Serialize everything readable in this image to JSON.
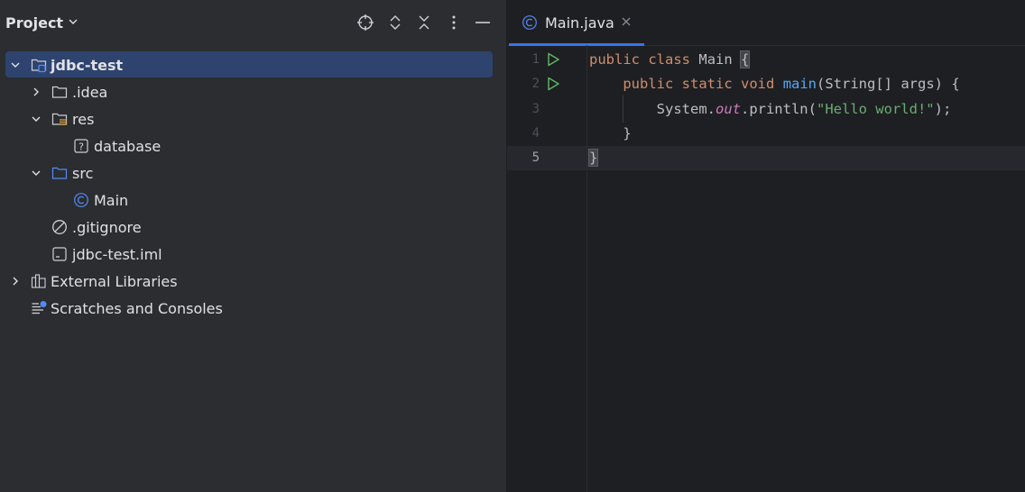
{
  "project_panel": {
    "title": "Project",
    "header_icons": [
      "locate-icon",
      "expand-all-icon",
      "collapse-all-icon",
      "more-options-icon",
      "minimize-icon"
    ],
    "tree": [
      {
        "label": "jdbc-test",
        "icon": "module-folder-icon",
        "expanded": true,
        "selected": true
      },
      {
        "label": ".idea",
        "icon": "folder-icon",
        "expanded": false
      },
      {
        "label": "res",
        "icon": "resources-folder-icon",
        "expanded": true
      },
      {
        "label": "database",
        "icon": "unknown-file-icon"
      },
      {
        "label": "src",
        "icon": "source-folder-icon",
        "expanded": true
      },
      {
        "label": "Main",
        "icon": "class-icon"
      },
      {
        "label": ".gitignore",
        "icon": "ignore-file-icon"
      },
      {
        "label": "jdbc-test.iml",
        "icon": "iml-file-icon"
      },
      {
        "label": "External Libraries",
        "icon": "libraries-icon",
        "expanded": false
      },
      {
        "label": "Scratches and Consoles",
        "icon": "scratches-icon"
      }
    ]
  },
  "editor": {
    "tab": {
      "label": "Main.java",
      "icon": "class-icon",
      "close_icon": "close-icon"
    },
    "line_numbers": [
      "1",
      "2",
      "3",
      "4",
      "5"
    ],
    "current_line": "5",
    "code": {
      "l1_kw1": "public",
      "l1_kw2": "class",
      "l1_name": "Main",
      "l1_brace": "{",
      "l2_kw1": "public",
      "l2_kw2": "static",
      "l2_kw3": "void",
      "l2_fn": "main",
      "l2_params": "(String[] args) {",
      "l3_obj": "System.",
      "l3_field": "out",
      "l3_call": ".println(",
      "l3_str": "\"Hello world!\"",
      "l3_end": ");",
      "l4": "}",
      "l5": "}"
    }
  },
  "colors": {
    "accent": "#3574f0",
    "keyword": "#cf8e6d",
    "function": "#56a8f5",
    "string": "#6aab73",
    "static_field": "#c77dbb",
    "run": "#5fb865"
  }
}
